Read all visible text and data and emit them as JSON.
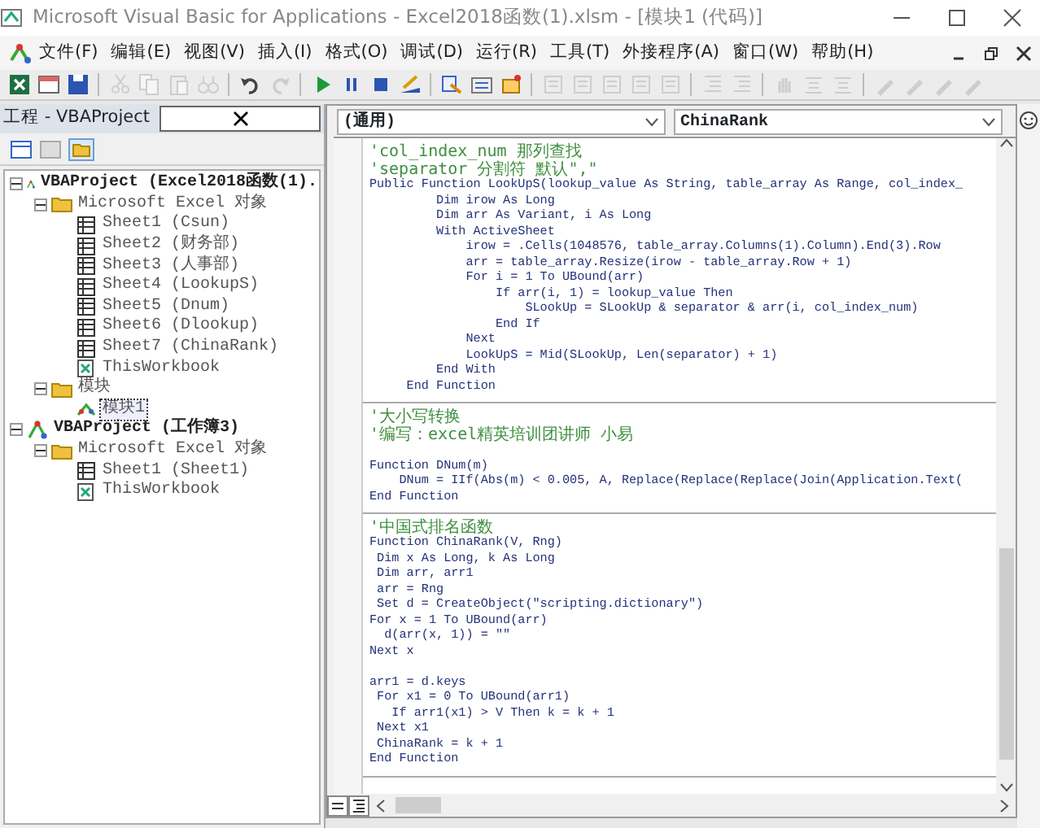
{
  "window": {
    "title": "Microsoft Visual Basic for Applications - Excel2018函数(1).xlsm - [模块1 (代码)]"
  },
  "menu": [
    "文件(F)",
    "编辑(E)",
    "视图(V)",
    "插入(I)",
    "格式(O)",
    "调试(D)",
    "运行(R)",
    "工具(T)",
    "外接程序(A)",
    "窗口(W)",
    "帮助(H)"
  ],
  "toolbar": [
    {
      "kind": "excel",
      "disabled": false
    },
    {
      "kind": "form",
      "disabled": false
    },
    {
      "kind": "save",
      "disabled": false
    },
    {
      "kind": "sep"
    },
    {
      "kind": "cut",
      "disabled": true
    },
    {
      "kind": "copy",
      "disabled": true
    },
    {
      "kind": "paste",
      "disabled": true
    },
    {
      "kind": "find",
      "disabled": true
    },
    {
      "kind": "sep"
    },
    {
      "kind": "undo",
      "disabled": false
    },
    {
      "kind": "redo",
      "disabled": true
    },
    {
      "kind": "sep"
    },
    {
      "kind": "run",
      "disabled": false
    },
    {
      "kind": "pause",
      "disabled": false
    },
    {
      "kind": "stop",
      "disabled": false
    },
    {
      "kind": "design",
      "disabled": false
    },
    {
      "kind": "sep"
    },
    {
      "kind": "explorer",
      "disabled": false
    },
    {
      "kind": "properties",
      "disabled": false
    },
    {
      "kind": "browser",
      "disabled": false
    },
    {
      "kind": "sep"
    },
    {
      "kind": "list",
      "disabled": true
    },
    {
      "kind": "list",
      "disabled": true
    },
    {
      "kind": "list",
      "disabled": true
    },
    {
      "kind": "list",
      "disabled": true
    },
    {
      "kind": "list",
      "disabled": true
    },
    {
      "kind": "sep"
    },
    {
      "kind": "indent",
      "disabled": true
    },
    {
      "kind": "indent",
      "disabled": true
    },
    {
      "kind": "sep"
    },
    {
      "kind": "hand",
      "disabled": true
    },
    {
      "kind": "comment",
      "disabled": true
    },
    {
      "kind": "comment",
      "disabled": true
    },
    {
      "kind": "sep"
    },
    {
      "kind": "bookmark",
      "disabled": true
    },
    {
      "kind": "bookmark",
      "disabled": true
    },
    {
      "kind": "bookmark",
      "disabled": true
    },
    {
      "kind": "bookmark",
      "disabled": true
    }
  ],
  "project_panel": {
    "title": "工程 - VBAProject",
    "tree": [
      {
        "label": "VBAProject (Excel2018函数(1).",
        "kind": "project",
        "expanded": true,
        "selected": false,
        "children": [
          {
            "label": "Microsoft Excel 对象",
            "kind": "folder",
            "expanded": true,
            "selected": false,
            "children": [
              {
                "label": "Sheet1 (Csun)",
                "kind": "sheet",
                "selected": false
              },
              {
                "label": "Sheet2 (财务部)",
                "kind": "sheet",
                "selected": false
              },
              {
                "label": "Sheet3 (人事部)",
                "kind": "sheet",
                "selected": false
              },
              {
                "label": "Sheet4 (LookupS)",
                "kind": "sheet",
                "selected": false
              },
              {
                "label": "Sheet5 (Dnum)",
                "kind": "sheet",
                "selected": false
              },
              {
                "label": "Sheet6 (Dlookup)",
                "kind": "sheet",
                "selected": false
              },
              {
                "label": "Sheet7 (ChinaRank)",
                "kind": "sheet",
                "selected": false
              },
              {
                "label": "ThisWorkbook",
                "kind": "workbook",
                "selected": false
              }
            ]
          },
          {
            "label": "模块",
            "kind": "folder",
            "expanded": true,
            "selected": false,
            "children": [
              {
                "label": "模块1",
                "kind": "module",
                "selected": true
              }
            ]
          }
        ]
      },
      {
        "label": "VBAProject (工作簿3)",
        "kind": "project",
        "expanded": true,
        "selected": false,
        "children": [
          {
            "label": "Microsoft Excel 对象",
            "kind": "folder",
            "expanded": true,
            "selected": false,
            "children": [
              {
                "label": "Sheet1 (Sheet1)",
                "kind": "sheet",
                "selected": false
              },
              {
                "label": "ThisWorkbook",
                "kind": "workbook",
                "selected": false
              }
            ]
          }
        ]
      }
    ]
  },
  "code_window": {
    "object": "(通用)",
    "procedure": "ChinaRank",
    "procedures": [
      {
        "lines": [
          {
            "kind": "comment",
            "text": "'col_index_num 那列查找"
          },
          {
            "kind": "comment",
            "text": "'separator 分割符 默认\",\""
          },
          {
            "kind": "code",
            "text": "Public Function LookUpS(lookup_value As String, table_array As Range, col_index_"
          },
          {
            "kind": "code",
            "text": "         Dim irow As Long"
          },
          {
            "kind": "code",
            "text": "         Dim arr As Variant, i As Long"
          },
          {
            "kind": "code",
            "text": "         With ActiveSheet"
          },
          {
            "kind": "code",
            "text": "             irow = .Cells(1048576, table_array.Columns(1).Column).End(3).Row"
          },
          {
            "kind": "code",
            "text": "             arr = table_array.Resize(irow - table_array.Row + 1)"
          },
          {
            "kind": "code",
            "text": "             For i = 1 To UBound(arr)"
          },
          {
            "kind": "code",
            "text": "                 If arr(i, 1) = lookup_value Then"
          },
          {
            "kind": "code",
            "text": "                     SLookUp = SLookUp & separator & arr(i, col_index_num)"
          },
          {
            "kind": "code",
            "text": "                 End If"
          },
          {
            "kind": "code",
            "text": "             Next"
          },
          {
            "kind": "code",
            "text": "             LookUpS = Mid(SLookUp, Len(separator) + 1)"
          },
          {
            "kind": "code",
            "text": "         End With"
          },
          {
            "kind": "code",
            "text": "     End Function"
          }
        ]
      },
      {
        "lines": [
          {
            "kind": "comment",
            "text": "'大小写转换"
          },
          {
            "kind": "comment",
            "text": "'编写：excel精英培训团讲师 小易"
          },
          {
            "kind": "blank"
          },
          {
            "kind": "code",
            "text": "Function DNum(m)"
          },
          {
            "kind": "code",
            "text": "    DNum = IIf(Abs(m) < 0.005, A, Replace(Replace(Replace(Join(Application.Text("
          },
          {
            "kind": "code",
            "text": "End Function"
          }
        ]
      },
      {
        "lines": [
          {
            "kind": "comment",
            "text": "'中国式排名函数"
          },
          {
            "kind": "code",
            "text": "Function ChinaRank(V, Rng)"
          },
          {
            "kind": "code",
            "text": " Dim x As Long, k As Long"
          },
          {
            "kind": "code",
            "text": " Dim arr, arr1"
          },
          {
            "kind": "code",
            "text": " arr = Rng"
          },
          {
            "kind": "code",
            "text": " Set d = CreateObject(\"scripting.dictionary\")"
          },
          {
            "kind": "code",
            "text": "For x = 1 To UBound(arr)"
          },
          {
            "kind": "code",
            "text": "  d(arr(x, 1)) = \"\""
          },
          {
            "kind": "code",
            "text": "Next x"
          },
          {
            "kind": "blank"
          },
          {
            "kind": "code",
            "text": "arr1 = d.keys"
          },
          {
            "kind": "code",
            "text": " For x1 = 0 To UBound(arr1)"
          },
          {
            "kind": "code",
            "text": "   If arr1(x1) > V Then k = k + 1"
          },
          {
            "kind": "code",
            "text": " Next x1"
          },
          {
            "kind": "code",
            "text": " ChinaRank = k + 1"
          },
          {
            "kind": "code",
            "text": "End Function"
          }
        ]
      }
    ]
  }
}
